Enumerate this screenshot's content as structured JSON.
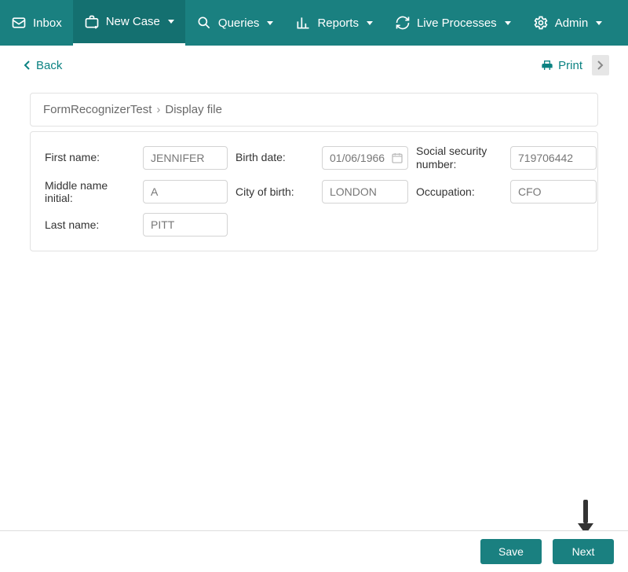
{
  "nav": {
    "inbox": "Inbox",
    "new_case": "New Case",
    "queries": "Queries",
    "reports": "Reports",
    "live_processes": "Live Processes",
    "admin": "Admin"
  },
  "subbar": {
    "back": "Back",
    "print": "Print"
  },
  "breadcrumb": {
    "root": "FormRecognizerTest",
    "sep": "›",
    "leaf": "Display file"
  },
  "form": {
    "labels": {
      "first_name": "First name:",
      "middle_initial": "Middle name initial:",
      "last_name": "Last name:",
      "birth_date": "Birth date:",
      "city_of_birth": "City of birth:",
      "ssn": "Social security number:",
      "occupation": "Occupation:"
    },
    "values": {
      "first_name": "JENNIFER",
      "middle_initial": "A",
      "last_name": "PITT",
      "birth_date": "01/06/1966",
      "city_of_birth": "LONDON",
      "ssn": "719706442",
      "occupation": "CFO"
    }
  },
  "footer": {
    "save": "Save",
    "next": "Next"
  }
}
